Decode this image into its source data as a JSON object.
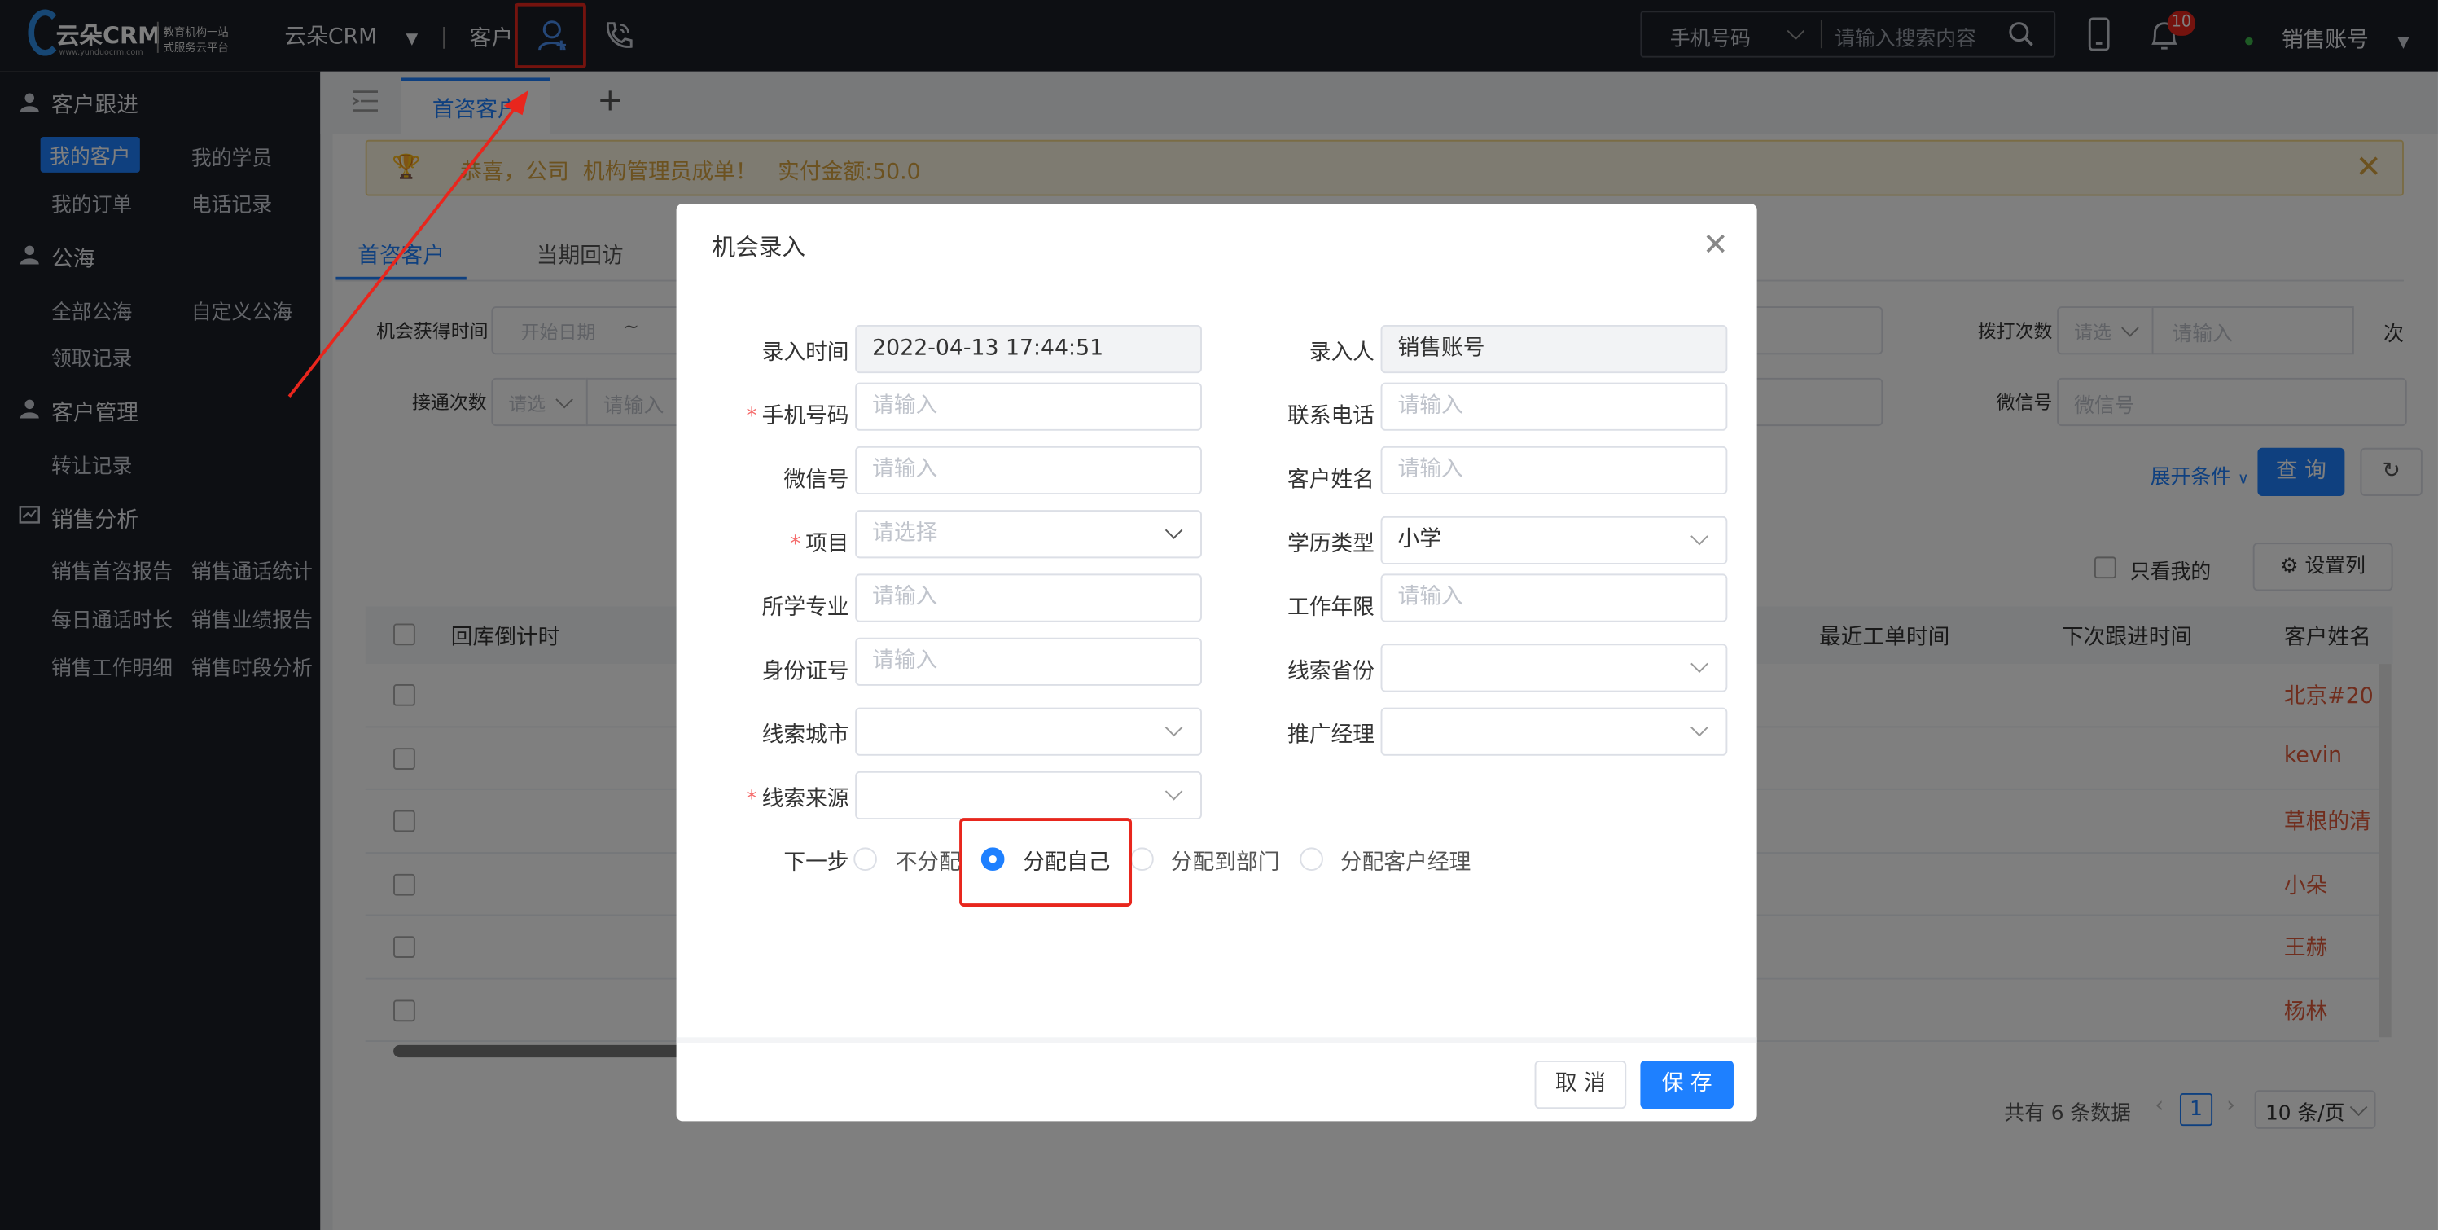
{
  "header": {
    "logo_text": "云朵CRM",
    "logo_tagline_1": "教育机构一站",
    "logo_tagline_2": "式服务云平台",
    "logo_url": "www.yunduocrm.com",
    "app_name": "云朵CRM",
    "nav_customer": "客户",
    "search_type": "手机号码",
    "search_placeholder": "请输入搜索内容",
    "notification_count": "10",
    "account": "销售账号"
  },
  "sidebar": {
    "sections": [
      {
        "title": "客户跟进",
        "items": [
          "我的客户",
          "我的学员",
          "我的订单",
          "电话记录"
        ]
      },
      {
        "title": "公海",
        "items": [
          "全部公海",
          "自定义公海",
          "领取记录"
        ]
      },
      {
        "title": "客户管理",
        "items": [
          "转让记录"
        ]
      },
      {
        "title": "销售分析",
        "items": [
          "销售首咨报告",
          "销售通话统计",
          "每日通话时长",
          "销售业绩报告",
          "销售工作明细",
          "销售时段分析"
        ]
      }
    ]
  },
  "tabs": {
    "active": "首咨客户",
    "add": "+"
  },
  "notice": {
    "text": "恭喜，公司  机构管理员成单！   实付金额:50.0"
  },
  "subtabs": [
    "首咨客户",
    "当期回访"
  ],
  "filters": {
    "opp_time_label": "机会获得时间",
    "start_date": "开始日期",
    "tilde": "~",
    "connect_label": "接通次数",
    "please_select": "请选",
    "please_input": "请输入",
    "dial_label": "拨打次数",
    "wechat_label": "微信号",
    "wechat_placeholder": "微信号",
    "next_label": "次",
    "expand": "展开条件",
    "query": "查 询",
    "only_mine": "只看我的",
    "set_columns": "设置列"
  },
  "table": {
    "headers": [
      "回库倒计时",
      "最近工单时间",
      "下次跟进时间",
      "客户姓名"
    ],
    "names": [
      "北京#20",
      "kevin",
      "草根的清",
      "小朵",
      "王赫",
      "杨林"
    ]
  },
  "pagination": {
    "total": "共有 6 条数据",
    "page": "1",
    "size": "10 条/页"
  },
  "dialog": {
    "title": "机会录入",
    "fields": {
      "entry_time_label": "录入时间",
      "entry_time_value": "2022-04-13 17:44:51",
      "entry_person_label": "录入人",
      "entry_person_value": "销售账号",
      "phone_label": "手机号码",
      "contact_phone_label": "联系电话",
      "wechat_label": "微信号",
      "customer_name_label": "客户姓名",
      "project_label": "项目",
      "project_placeholder": "请选择",
      "education_label": "学历类型",
      "education_value": "小学",
      "major_label": "所学专业",
      "work_years_label": "工作年限",
      "id_label": "身份证号",
      "province_label": "线索省份",
      "city_label": "线索城市",
      "promo_manager_label": "推广经理",
      "source_label": "线索来源",
      "input_placeholder": "请输入",
      "required_mark": "*"
    },
    "next_step": {
      "label": "下一步",
      "options": [
        "不分配",
        "分配自己",
        "分配到部门",
        "分配客户经理"
      ],
      "selected": "分配自己"
    },
    "cancel": "取 消",
    "save": "保 存"
  },
  "colors": {
    "accent": "#1e80ff",
    "annotation": "#e8261d",
    "dark": "#1b1e27"
  }
}
